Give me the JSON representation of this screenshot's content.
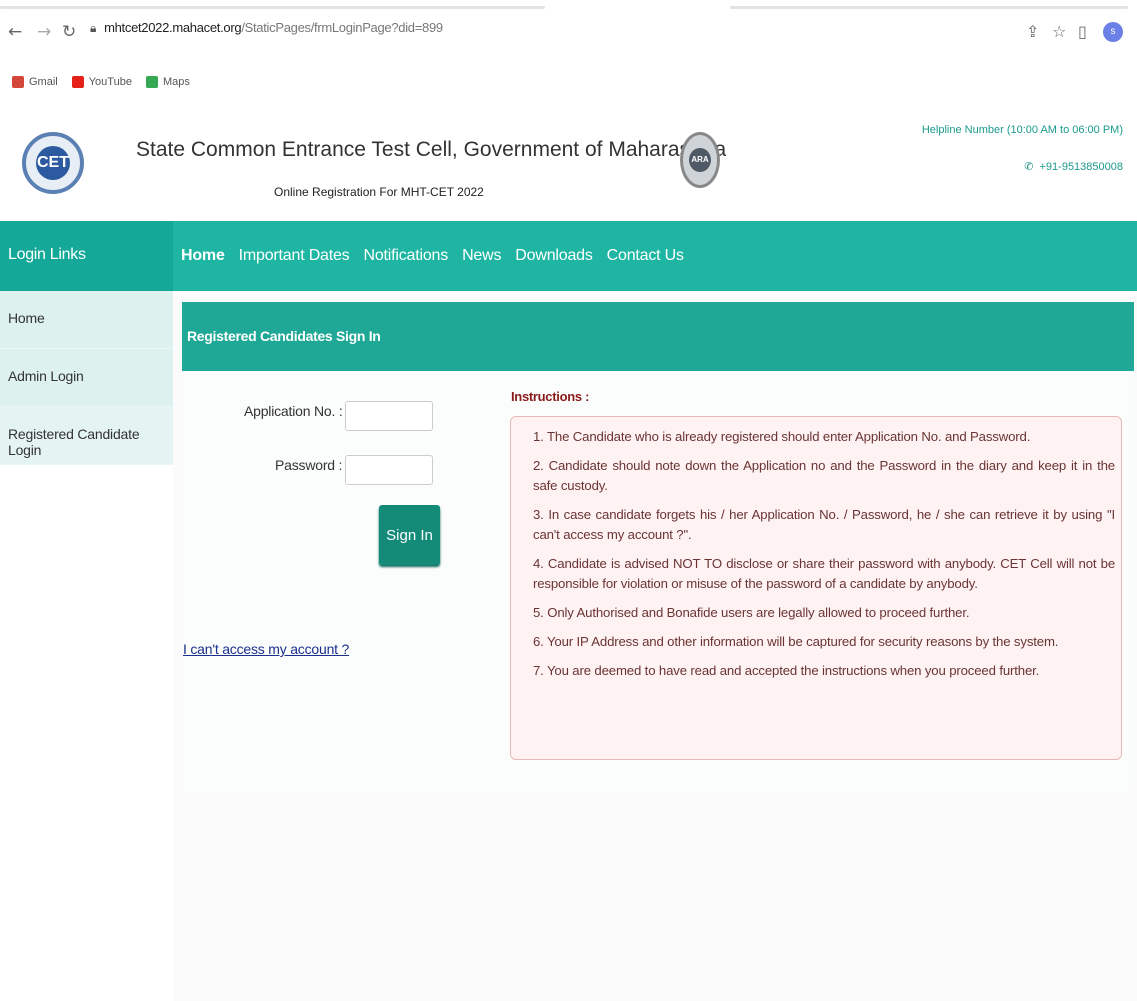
{
  "browser": {
    "back_icon": "back-arrow-icon",
    "forward_icon": "forward-arrow-icon",
    "reload_icon": "reload-icon",
    "url_host": "mhtcet2022.mahacet.org",
    "url_path": "/StaticPages/frmLoginPage?did=899",
    "profile_initial": "s",
    "bookmarks": [
      {
        "label": "Gmail",
        "icon": "gmail-icon",
        "color": "#d44638"
      },
      {
        "label": "YouTube",
        "icon": "youtube-icon",
        "color": "#e62117"
      },
      {
        "label": "Maps",
        "icon": "maps-icon",
        "color": "#34a853"
      }
    ]
  },
  "header": {
    "title": "State Common Entrance Test Cell, Government of Maharashtra",
    "subtitle": "Online Registration For MHT-CET 2022",
    "helpline_label": "Helpline Number (10:00 AM to 06:00 PM)",
    "helpline_number": "+91-9513850008",
    "logo_left_text": "CET",
    "logo_right_text": "ARA"
  },
  "nav": {
    "sidebar_title": "Login Links",
    "items": [
      "Home",
      "Important Dates",
      "Notifications",
      "News",
      "Downloads",
      "Contact Us"
    ],
    "active": "Home"
  },
  "sidebar": {
    "links": [
      "Home",
      "Admin Login",
      "Registered Candidate Login"
    ]
  },
  "login": {
    "panel_title": "Registered Candidates Sign In",
    "application_label": "Application No. :",
    "application_value": "",
    "password_label": "Password :",
    "password_value": "",
    "signin_label": "Sign In",
    "cant_access": "I can't access my account ?"
  },
  "instructions": {
    "title": "Instructions :",
    "items": [
      "1. The Candidate who is already registered should enter Application No. and Password.",
      "2. Candidate should note down the Application no and the Password in the diary and keep it in the safe custody.",
      "3. In case candidate forgets his / her Application No. / Password, he / she can retrieve it by using \"I can't access my account ?\".",
      "4. Candidate is advised NOT TO disclose or share their password with anybody. CET Cell will not be responsible for violation or misuse of the password of a candidate by anybody.",
      "5. Only Authorised and Bonafide users are legally allowed to proceed further.",
      "6. Your IP Address and other information will be captured for security reasons by the system.",
      "7. You are deemed to have read and accepted the instructions when you proceed further."
    ]
  },
  "colors": {
    "teal": "#1fb5a3",
    "teal_dark": "#148a78",
    "instruction_text": "#6a3434",
    "instruction_bg": "#fff2f2"
  }
}
